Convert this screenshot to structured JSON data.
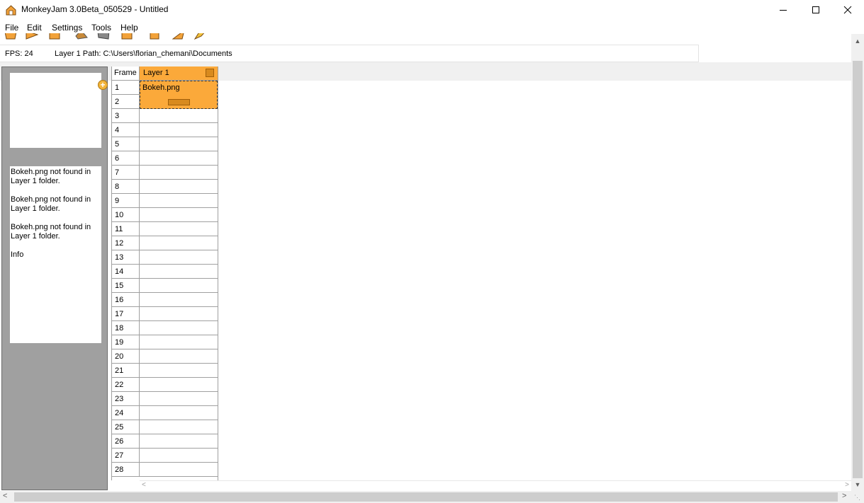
{
  "window": {
    "title": "MonkeyJam 3.0Beta_050529 - Untitled",
    "minimize_icon": "minimize-icon",
    "maximize_icon": "maximize-icon",
    "close_icon": "close-icon"
  },
  "menu": {
    "items": [
      "File",
      "Edit",
      "Settings",
      "Tools",
      "Help"
    ]
  },
  "status": {
    "fps": "FPS: 24",
    "layer_path": "Layer 1 Path: C:\\Users\\florian_chemani\\Documents"
  },
  "info": {
    "messages": [
      "Bokeh.png not found in Layer 1 folder.",
      "Bokeh.png not found in Layer 1 folder.",
      "Bokeh.png not found in Layer 1 folder.",
      "Info"
    ]
  },
  "timesheet": {
    "frame_header": "Frame",
    "frames": [
      "1",
      "2",
      "3",
      "4",
      "5",
      "6",
      "7",
      "8",
      "9",
      "10",
      "11",
      "12",
      "13",
      "14",
      "15",
      "16",
      "17",
      "18",
      "19",
      "20",
      "21",
      "22",
      "23",
      "24",
      "25",
      "26",
      "27",
      "28"
    ],
    "layers": [
      {
        "name": "Layer 1",
        "clip": "Bokeh.png"
      }
    ]
  },
  "colors": {
    "layer_accent": "#fba93a",
    "panel_grey": "#a0a0a0"
  }
}
